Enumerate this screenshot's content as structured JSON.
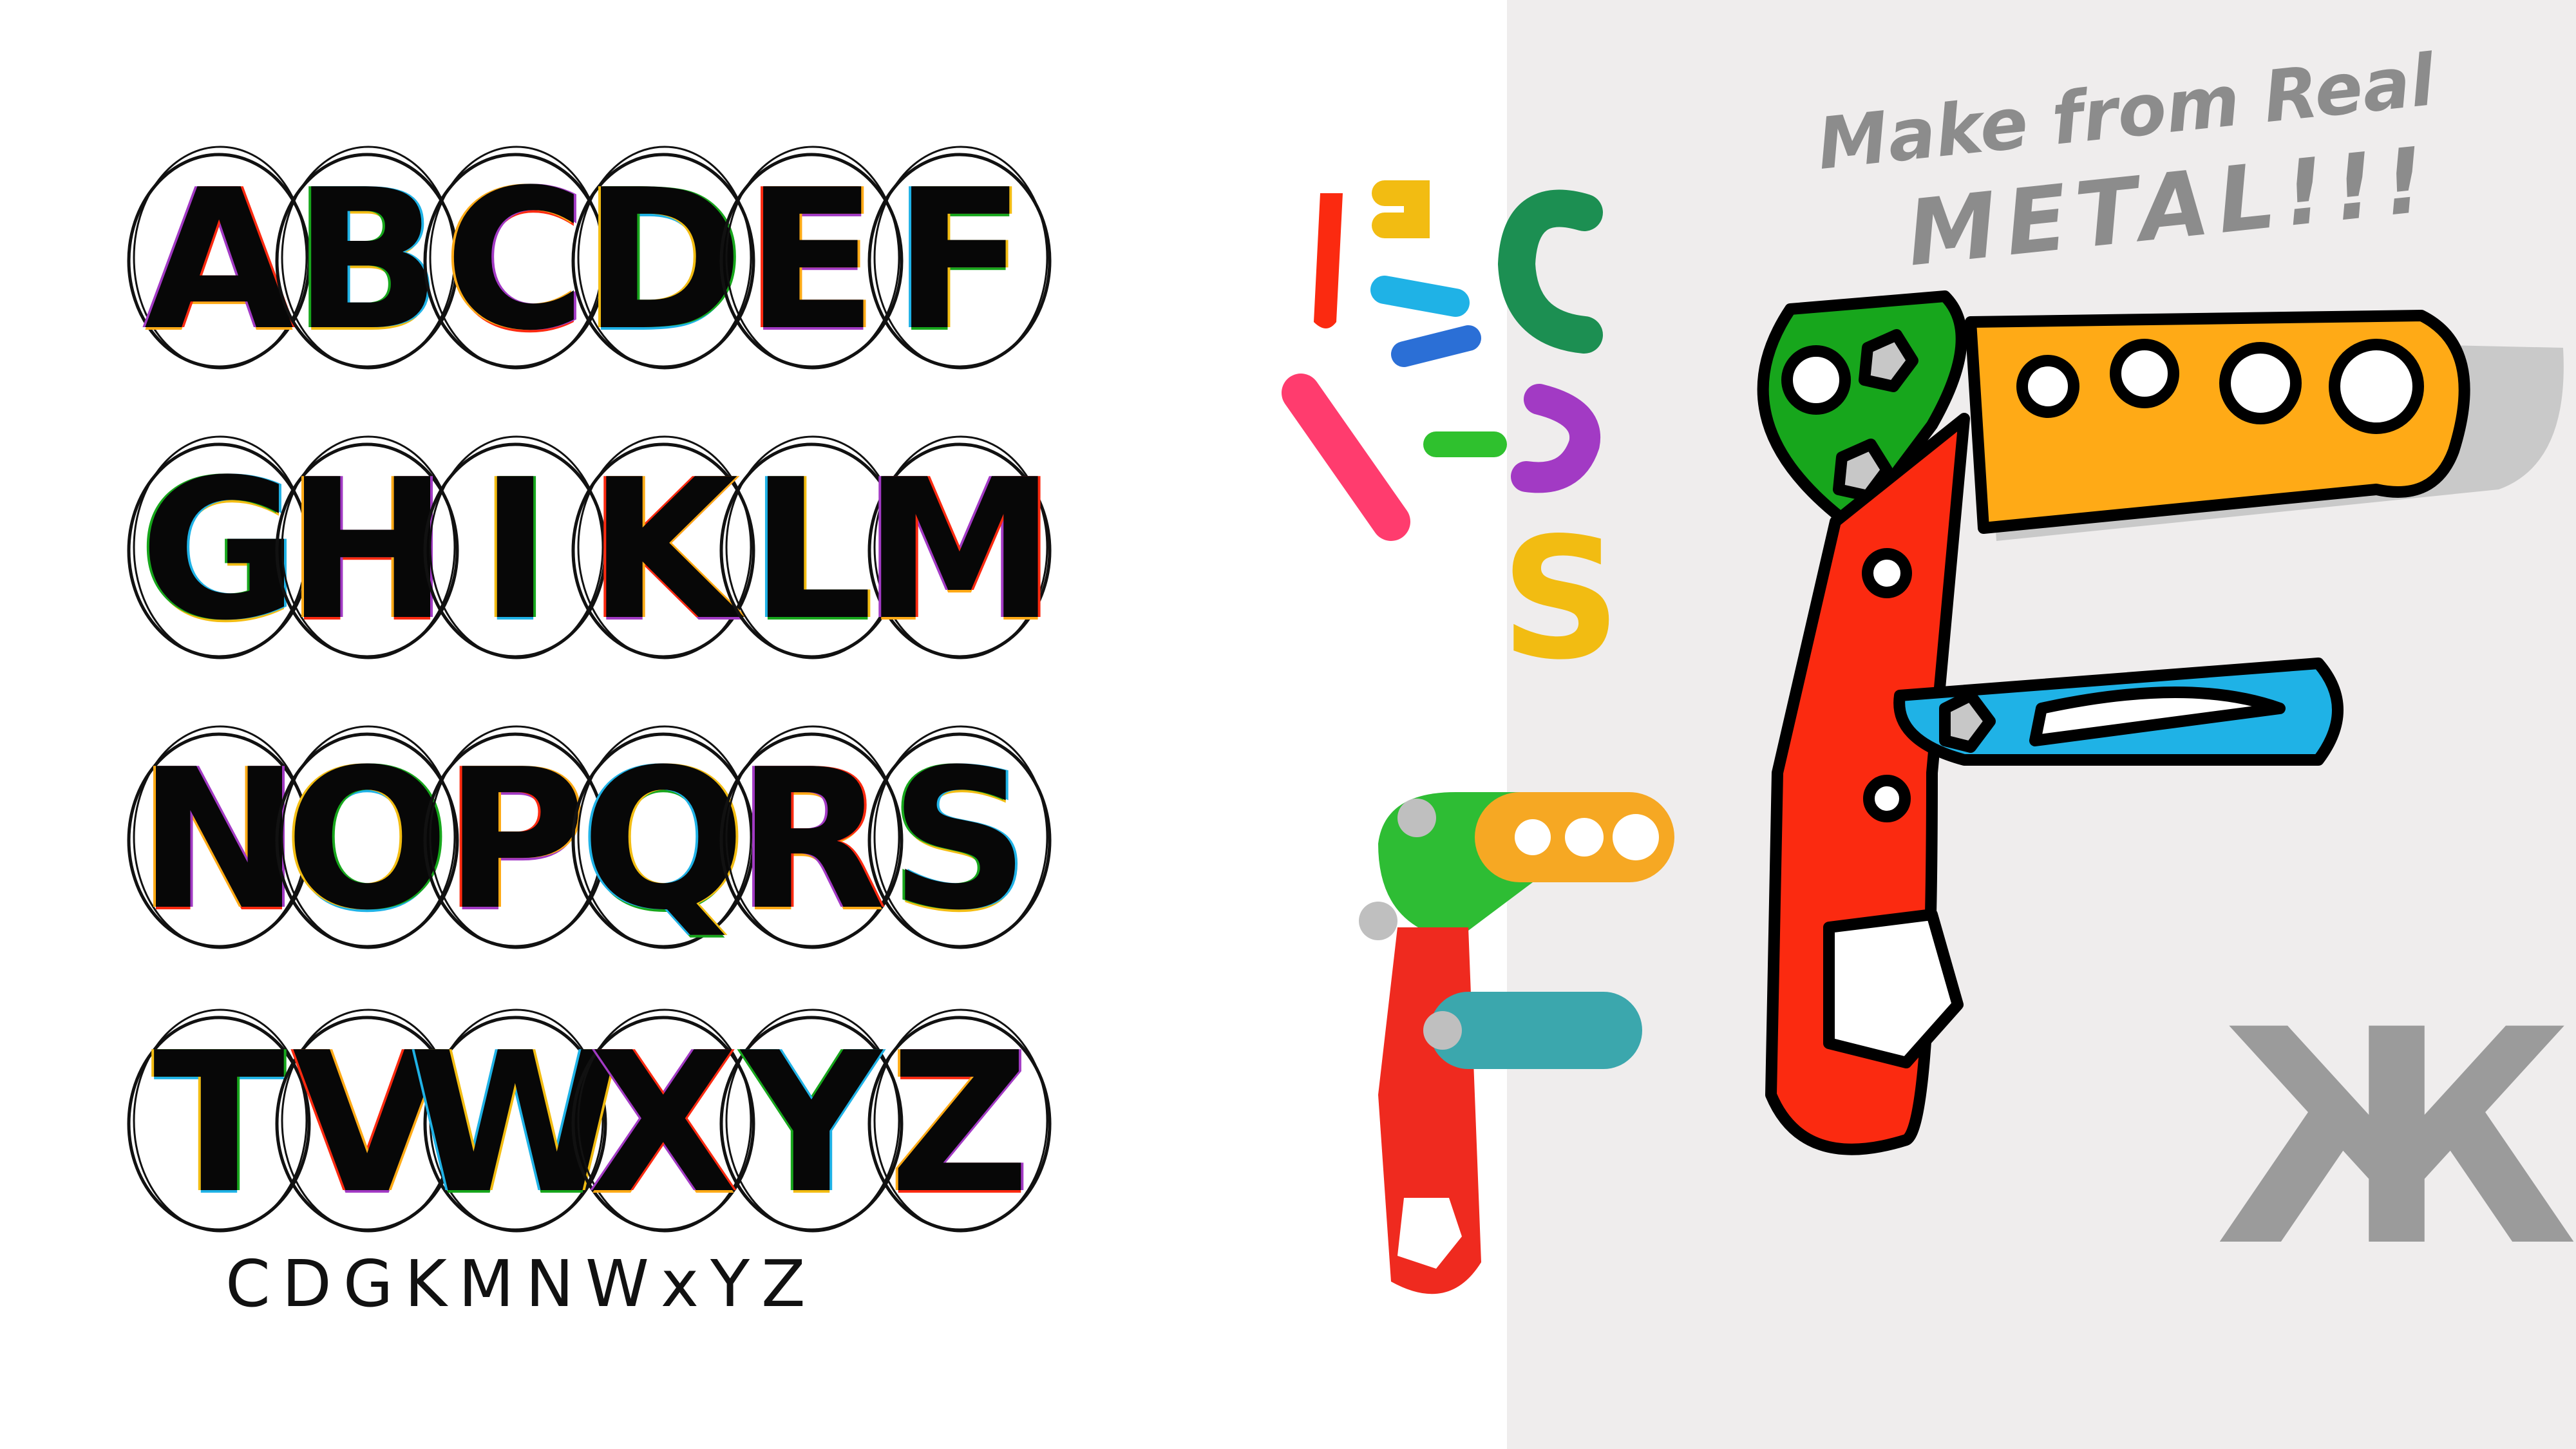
{
  "rows": [
    [
      "A",
      "B",
      "C",
      "D",
      "E",
      "F"
    ],
    [
      "G",
      "H",
      "I",
      "K",
      "L",
      "M"
    ],
    [
      "N",
      "O",
      "P",
      "Q",
      "R",
      "S"
    ],
    [
      "T",
      "V",
      "W",
      "X",
      "Y",
      "Z"
    ]
  ],
  "sample_text": "CDGKMNWxYZ",
  "handwritten_line1": "Make from Real",
  "handwritten_line2": "METAL!!!",
  "stroke_sample_letter": "C",
  "stroke_sample_letter2": "S",
  "cyrillic_glyph": "Ж",
  "colors": {
    "red": "#fb2a10",
    "orange": "#ffaa16",
    "green": "#17a61c",
    "blue": "#1fb2e6",
    "purple": "#a23ac4",
    "pink": "#ff3c6e",
    "yellow": "#f2bc12",
    "teal": "#1c8f52",
    "gray": "#9b9b9b",
    "background_right": "#efeded"
  }
}
